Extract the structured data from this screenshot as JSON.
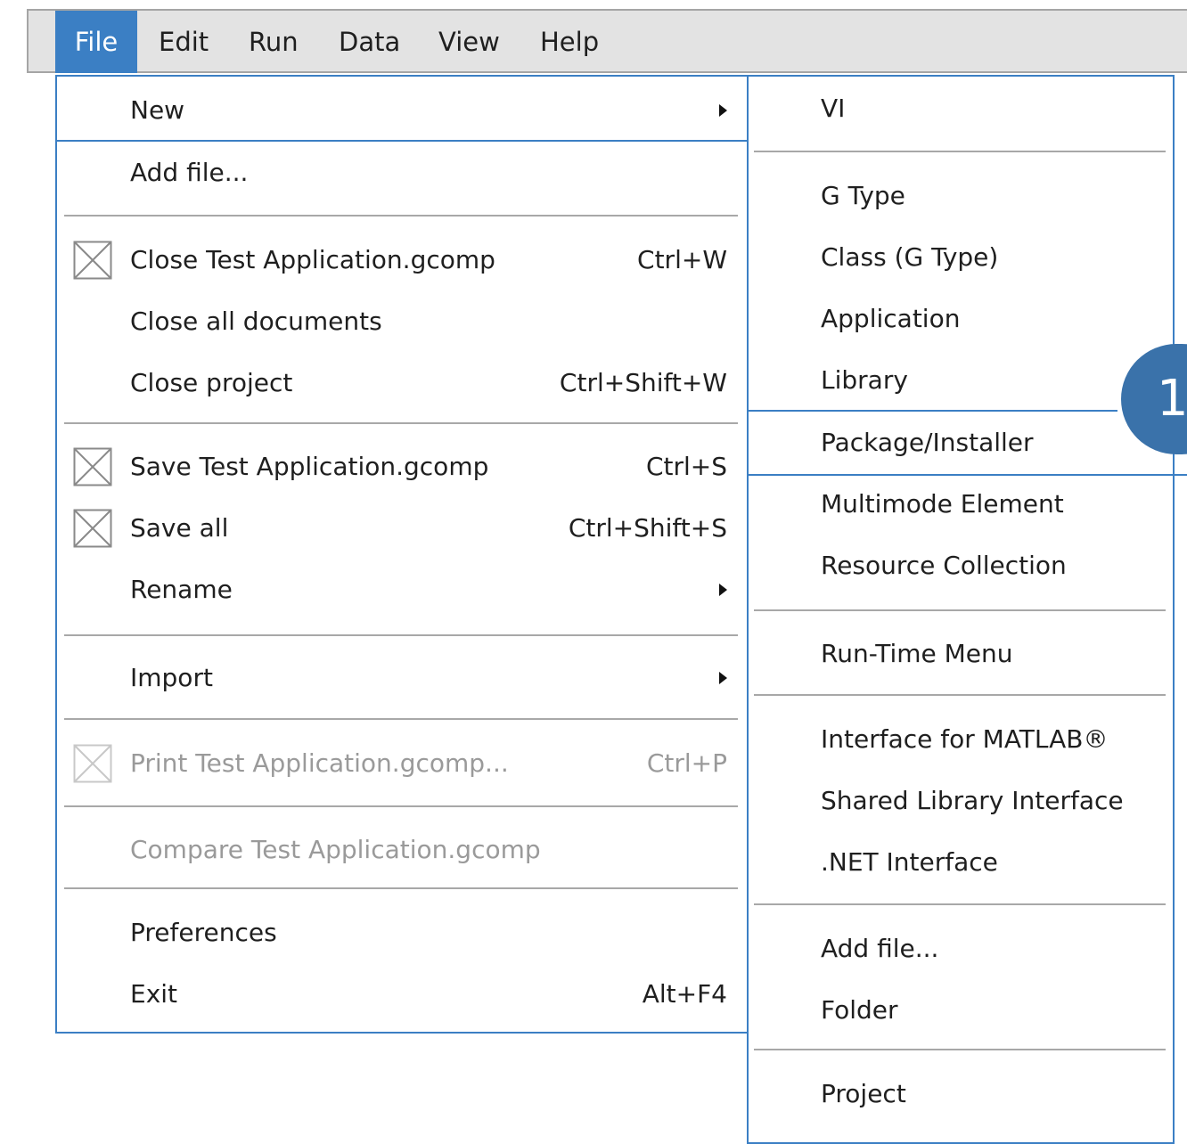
{
  "menubar": {
    "items": [
      {
        "label": "File",
        "active": true
      },
      {
        "label": "Edit"
      },
      {
        "label": "Run"
      },
      {
        "label": "Data"
      },
      {
        "label": "View"
      },
      {
        "label": "Help"
      }
    ]
  },
  "file_menu": {
    "new": {
      "label": "New",
      "has_submenu": true
    },
    "add_file": {
      "label": "Add file..."
    },
    "close_doc": {
      "label": "Close Test Application.gcomp",
      "shortcut": "Ctrl+W",
      "icon": "close-box-icon"
    },
    "close_all": {
      "label": "Close all documents"
    },
    "close_project": {
      "label": "Close project",
      "shortcut": "Ctrl+Shift+W"
    },
    "save_doc": {
      "label": "Save Test Application.gcomp",
      "shortcut": "Ctrl+S",
      "icon": "close-box-icon"
    },
    "save_all": {
      "label": "Save all",
      "shortcut": "Ctrl+Shift+S",
      "icon": "close-box-icon"
    },
    "rename": {
      "label": "Rename",
      "has_submenu": true
    },
    "import": {
      "label": "Import",
      "has_submenu": true
    },
    "print": {
      "label": "Print Test Application.gcomp...",
      "shortcut": "Ctrl+P",
      "disabled": true
    },
    "compare": {
      "label": "Compare Test Application.gcomp",
      "disabled": true
    },
    "preferences": {
      "label": "Preferences"
    },
    "exit": {
      "label": "Exit",
      "shortcut": "Alt+F4"
    }
  },
  "new_submenu": {
    "vi": "VI",
    "g_type": "G Type",
    "class_g_type": "Class (G Type)",
    "application": "Application",
    "library": "Library",
    "package_installer": "Package/Installer",
    "multimode_element": "Multimode Element",
    "resource_collection": "Resource Collection",
    "run_time_menu": "Run-Time Menu",
    "interface_matlab": "Interface for MATLAB®",
    "shared_library_interface": "Shared Library Interface",
    "net_interface": ".NET Interface",
    "add_file": "Add file...",
    "folder": "Folder",
    "project": "Project"
  },
  "callout": {
    "number": "1"
  },
  "colors": {
    "accent": "#3b7fc4",
    "menubar_bg": "#e3e3e3",
    "disabled_text": "#9a9a9a"
  }
}
